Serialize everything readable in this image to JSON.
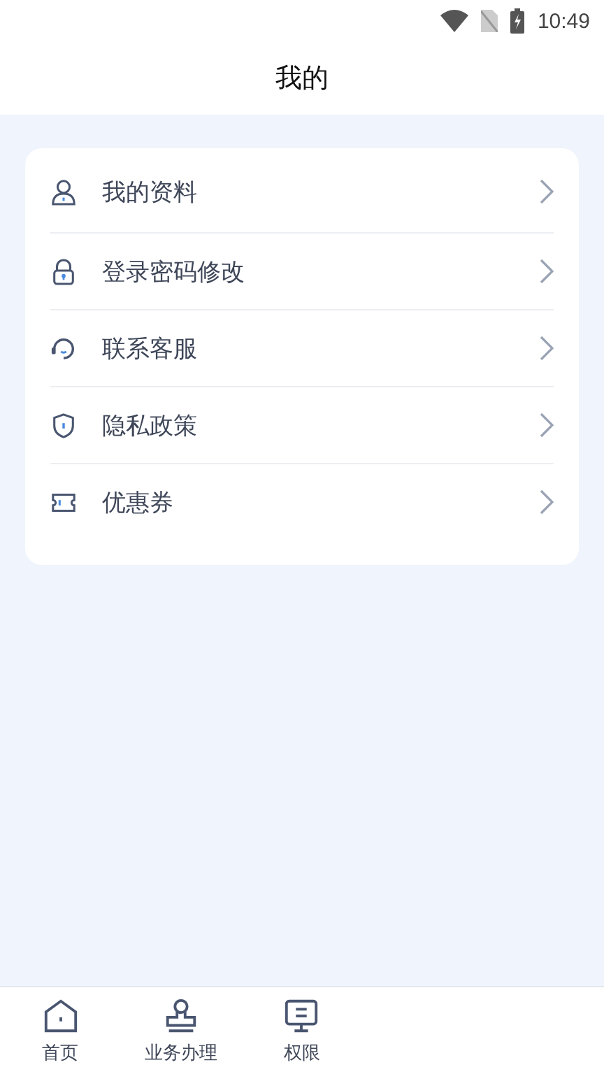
{
  "status_bar": {
    "time": "10:49"
  },
  "header": {
    "title": "我的"
  },
  "menu": [
    {
      "label": "我的资料"
    },
    {
      "label": "登录密码修改"
    },
    {
      "label": "联系客服"
    },
    {
      "label": "隐私政策"
    },
    {
      "label": "优惠券"
    }
  ],
  "tab_bar": [
    {
      "label": "首页"
    },
    {
      "label": "业务办理"
    },
    {
      "label": "权限"
    }
  ]
}
